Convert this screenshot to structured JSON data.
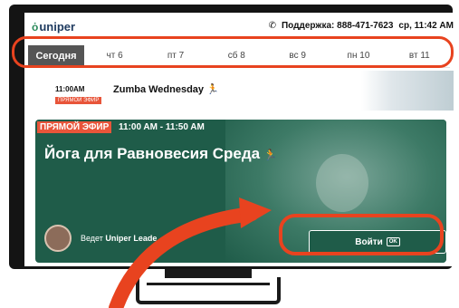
{
  "header": {
    "logo_text": "uniper",
    "support_label": "Поддержка: 888-471-7623",
    "time_label": "ср, 11:42 AM"
  },
  "days": [
    {
      "label": "Сегодня",
      "active": true
    },
    {
      "label": "чт 6"
    },
    {
      "label": "пт 7"
    },
    {
      "label": "сб 8"
    },
    {
      "label": "вс 9"
    },
    {
      "label": "пн 10"
    },
    {
      "label": "вт 11"
    }
  ],
  "previous_class": {
    "time": "11:00AM",
    "title": "Zumba Wednesday",
    "live_label": "ПРЯМОЙ ЭФИР"
  },
  "current_class": {
    "live_label": "ПРЯМОЙ ЭФИР",
    "time_range": "11:00 AM - 11:50 AM",
    "title": "Йога для Равновесия Среда",
    "host_prefix": "Ведет",
    "host_name": "Uniper Leade",
    "join_label": "Войти",
    "ok_label": "OK"
  },
  "colors": {
    "card_green": "#1f5c49",
    "live_red": "#e8553a",
    "highlight_orange": "#e8431f"
  }
}
